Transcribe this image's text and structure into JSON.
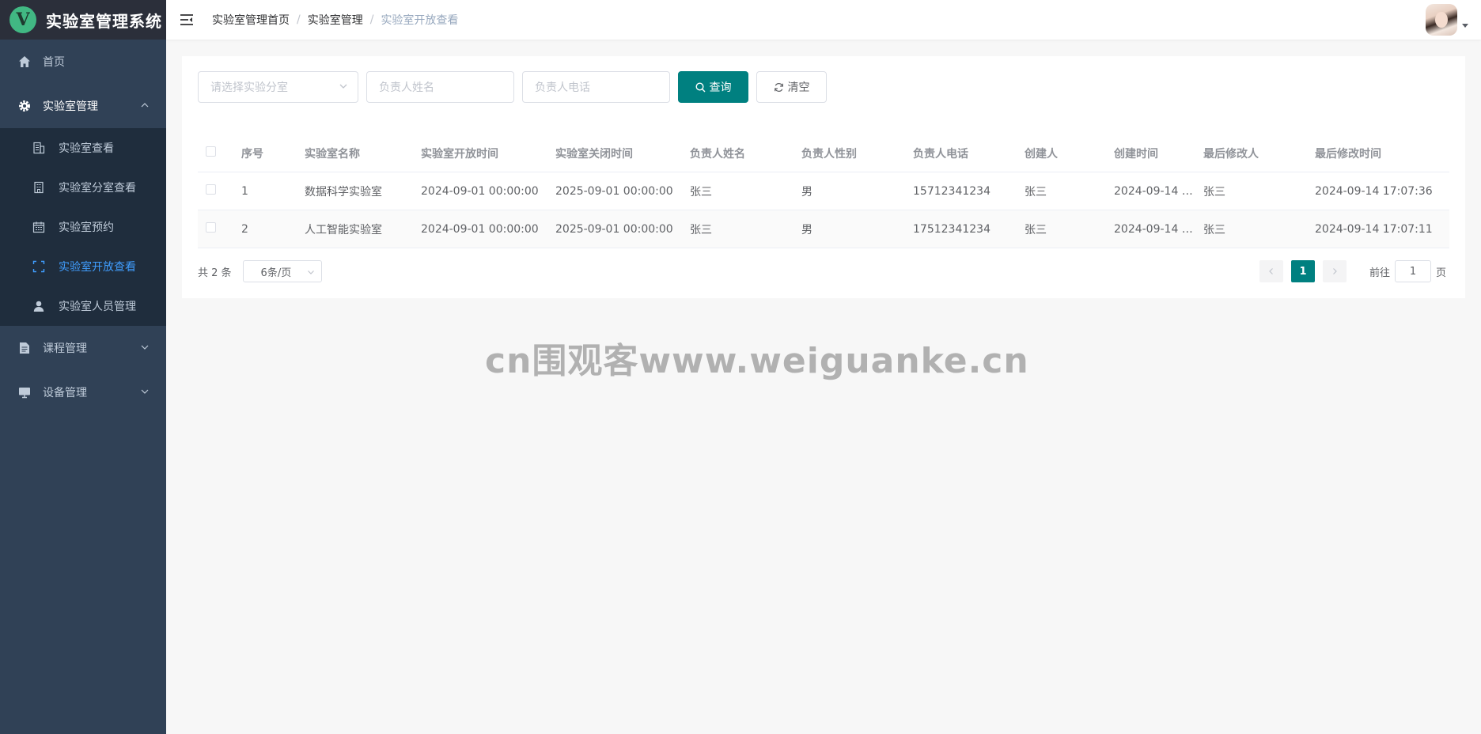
{
  "app": {
    "logo_letter": "V",
    "title": "实验室管理系统"
  },
  "sidebar": {
    "items": [
      {
        "label": "首页",
        "icon": "home-icon"
      },
      {
        "label": "实验室管理",
        "icon": "gear-icon",
        "expanded": true,
        "children": [
          {
            "label": "实验室查看",
            "icon": "building-icon"
          },
          {
            "label": "实验室分室查看",
            "icon": "office-icon"
          },
          {
            "label": "实验室预约",
            "icon": "calendar-icon"
          },
          {
            "label": "实验室开放查看",
            "icon": "full-screen-icon",
            "active": true
          },
          {
            "label": "实验室人员管理",
            "icon": "user-icon"
          }
        ]
      },
      {
        "label": "课程管理",
        "icon": "document-icon"
      },
      {
        "label": "设备管理",
        "icon": "monitor-icon"
      }
    ]
  },
  "header": {
    "breadcrumb": [
      "实验室管理首页",
      "实验室管理",
      "实验室开放查看"
    ]
  },
  "search": {
    "branch_placeholder": "请选择实验分室",
    "name_placeholder": "负责人姓名",
    "phone_placeholder": "负责人电话",
    "query_label": "查询",
    "clear_label": "清空"
  },
  "table": {
    "columns": [
      "序号",
      "实验室名称",
      "实验室开放时间",
      "实验室关闭时间",
      "负责人姓名",
      "负责人性别",
      "负责人电话",
      "创建人",
      "创建时间",
      "最后修改人",
      "最后修改时间"
    ],
    "rows": [
      [
        "1",
        "数据科学实验室",
        "2024-09-01 00:00:00",
        "2025-09-01 00:00:00",
        "张三",
        "男",
        "15712341234",
        "张三",
        "2024-09-14 …",
        "张三",
        "2024-09-14 17:07:36"
      ],
      [
        "2",
        "人工智能实验室",
        "2024-09-01 00:00:00",
        "2025-09-01 00:00:00",
        "张三",
        "男",
        "17512341234",
        "张三",
        "2024-09-14 …",
        "张三",
        "2024-09-14 17:07:11"
      ]
    ]
  },
  "pagination": {
    "total": "共 2 条",
    "page_size": "6条/页",
    "current_page": "1",
    "goto_prefix": "前往",
    "goto_value": "1",
    "goto_suffix": "页"
  },
  "watermark": "cn围观客www.weiguanke.cn",
  "colors": {
    "sidebar_bg": "#304156",
    "submenu_bg": "#1f2d3d",
    "active_menu": "#409eff",
    "primary": "#008080"
  }
}
